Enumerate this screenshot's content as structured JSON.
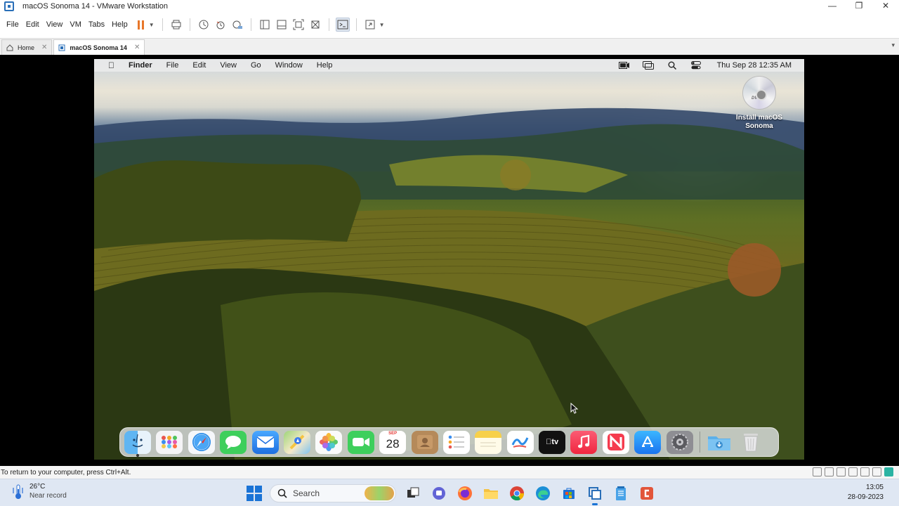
{
  "window": {
    "title": "macOS Sonoma 14 - VMware Workstation",
    "controls": [
      "—",
      "❐",
      "✕"
    ]
  },
  "menu": [
    "File",
    "Edit",
    "View",
    "VM",
    "Tabs",
    "Help"
  ],
  "tabs": [
    {
      "label": "Home",
      "close": "✕"
    },
    {
      "label": "macOS Sonoma 14",
      "close": "✕"
    }
  ],
  "tab_menu": "▾",
  "mac": {
    "menubar": {
      "app": "Finder",
      "items": [
        "File",
        "Edit",
        "View",
        "Go",
        "Window",
        "Help"
      ],
      "clock": "Thu Sep 28  12:35 AM"
    },
    "desktop_icon": {
      "disc_label": "DVD",
      "name_line1": "Install macOS",
      "name_line2": "Sonoma"
    },
    "dock": {
      "calendar_month": "SEP",
      "calendar_day": "28",
      "tv_label": "tv",
      "items": [
        "finder-icon",
        "launchpad-icon",
        "safari-icon",
        "messages-icon",
        "mail-icon",
        "maps-icon",
        "photos-icon",
        "facetime-icon",
        "calendar-icon",
        "contacts-icon",
        "reminders-icon",
        "notes-icon",
        "freeform-icon",
        "apple-tv-icon",
        "music-icon",
        "news-icon",
        "app-store-icon",
        "system-settings-icon",
        "downloads-folder-icon",
        "trash-icon"
      ]
    }
  },
  "status": {
    "hint": "To return to your computer, press Ctrl+Alt."
  },
  "taskbar": {
    "temperature": "26°C",
    "condition": "Near record",
    "search_placeholder": "Search",
    "time": "13:05",
    "date": "28-09-2023"
  },
  "colors": {
    "vmware_pause": "#e8772a",
    "windows_accent": "#1a73d6",
    "taskbar_bg": "#dfe7f3"
  }
}
